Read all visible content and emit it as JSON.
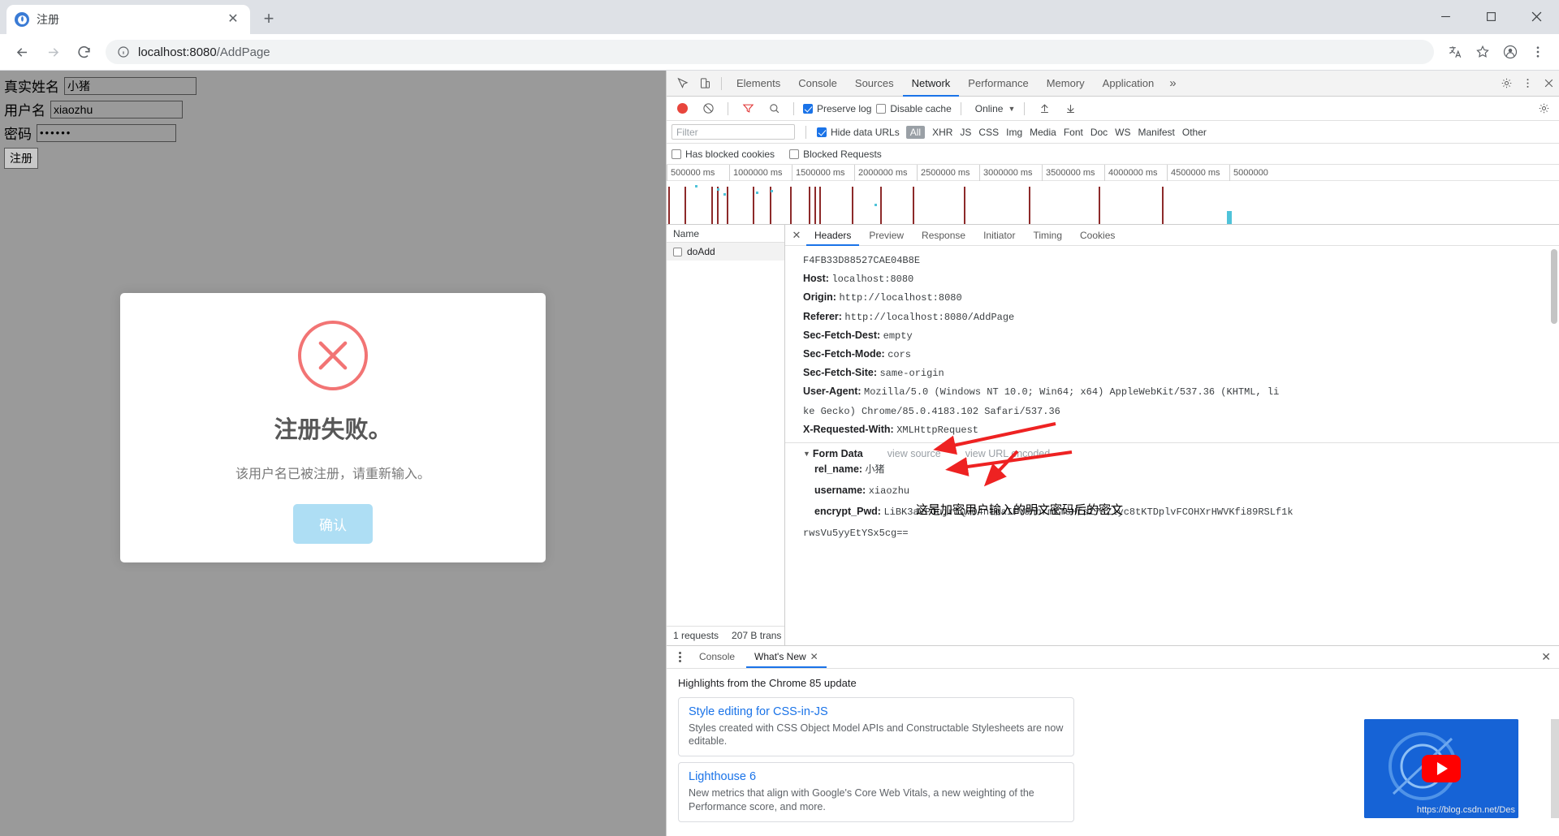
{
  "browser": {
    "tab": {
      "title": "注册",
      "close_label": "✕"
    },
    "new_tab_label": "+",
    "window_controls": {
      "minimize": "minimize-icon",
      "maximize": "maximize-icon",
      "close": "close-icon"
    },
    "nav": {
      "back": "back-icon",
      "forward": "forward-icon",
      "reload": "reload-icon"
    },
    "omnibox": {
      "info_icon": "info-icon",
      "host": "localhost:8080",
      "path": "/AddPage"
    },
    "toolbar_icons": [
      "translate-icon",
      "star-icon",
      "profile-icon",
      "menu-icon"
    ]
  },
  "page": {
    "fields": [
      {
        "label": "真实姓名",
        "value": "小猪",
        "name": "rel_name"
      },
      {
        "label": "用户名",
        "value": "xiaozhu",
        "name": "username"
      },
      {
        "label": "密码",
        "value": "••••••",
        "name": "password"
      }
    ],
    "submit_label": "注册",
    "modal": {
      "icon": "error-circle-x-icon",
      "icon_color": "#f27474",
      "title": "注册失败。",
      "message": "该用户名已被注册，请重新输入。",
      "button_label": "确认",
      "button_color": "#aedef4"
    }
  },
  "devtools": {
    "tabs": [
      "Elements",
      "Console",
      "Sources",
      "Network",
      "Performance",
      "Memory",
      "Application"
    ],
    "active_tab": "Network",
    "more_label": "»",
    "top_icons": [
      "inspect-icon",
      "device-toolbar-icon"
    ],
    "right_icons": [
      "settings-gear-icon",
      "more-vertical-icon",
      "close-icon"
    ],
    "controls": {
      "record_label": "record-icon",
      "clear_label": "clear-icon",
      "filter_label": "filter-icon",
      "search_label": "search-icon",
      "preserve_log": "Preserve log",
      "preserve_log_checked": true,
      "disable_cache": "Disable cache",
      "disable_cache_checked": false,
      "throttle": "Online",
      "import_icon": "upload-icon",
      "export_icon": "download-icon",
      "settings_icon": "gear-icon"
    },
    "filterbar": {
      "placeholder": "Filter",
      "hide_data_urls": "Hide data URLs",
      "hide_data_urls_checked": true,
      "types": [
        "All",
        "XHR",
        "JS",
        "CSS",
        "Img",
        "Media",
        "Font",
        "Doc",
        "WS",
        "Manifest",
        "Other"
      ],
      "active_type": "All"
    },
    "blockbar": {
      "has_blocked_cookies": "Has blocked cookies",
      "has_blocked_cookies_checked": false,
      "blocked_requests": "Blocked Requests",
      "blocked_requests_checked": false
    },
    "overview_ticks": [
      "500000 ms",
      "1000000 ms",
      "1500000 ms",
      "2000000 ms",
      "2500000 ms",
      "3000000 ms",
      "3500000 ms",
      "4000000 ms",
      "4500000 ms",
      "5000000"
    ],
    "requests": {
      "column_header": "Name",
      "items": [
        {
          "name": "doAdd"
        }
      ],
      "footer": {
        "count": "1 requests",
        "transferred": "207 B trans"
      }
    },
    "details": {
      "tabs": [
        "Headers",
        "Preview",
        "Response",
        "Initiator",
        "Timing",
        "Cookies"
      ],
      "active_tab": "Headers",
      "close_label": "✕",
      "headers": [
        {
          "name": "",
          "value": "F4FB33D88527CAE04B8E"
        },
        {
          "name": "Host:",
          "value": "localhost:8080"
        },
        {
          "name": "Origin:",
          "value": "http://localhost:8080"
        },
        {
          "name": "Referer:",
          "value": "http://localhost:8080/AddPage"
        },
        {
          "name": "Sec-Fetch-Dest:",
          "value": "empty"
        },
        {
          "name": "Sec-Fetch-Mode:",
          "value": "cors"
        },
        {
          "name": "Sec-Fetch-Site:",
          "value": "same-origin"
        },
        {
          "name": "User-Agent:",
          "value": "Mozilla/5.0 (Windows NT 10.0; Win64; x64) AppleWebKit/537.36 (KHTML, li"
        },
        {
          "name": "",
          "value": "ke Gecko) Chrome/85.0.4183.102 Safari/537.36"
        },
        {
          "name": "X-Requested-With:",
          "value": "XMLHttpRequest"
        }
      ],
      "form_data": {
        "title": "Form Data",
        "view_source": "view source",
        "view_url_encoded": "view URL encoded",
        "rows": [
          {
            "key": "rel_name:",
            "value": "小猪"
          },
          {
            "key": "username:",
            "value": "xiaozhu"
          },
          {
            "key": "encrypt_Pwd:",
            "value": "LiBK3aVPOujrIQv04nLoaIFV8nhrmKTsHfsZ7sZlyc8tKTDplvFCOHXrHWVKfi89RSLf1k"
          },
          {
            "key": "",
            "value": "rwsVu5yyEtYSx5cg=="
          }
        ]
      }
    },
    "annotation": "这是加密用户输入的明文密码后的密文",
    "drawer": {
      "kebab": "more-options-icon",
      "tabs": [
        "Console",
        "What's New"
      ],
      "active_tab": "What's New",
      "tab_close": "✕",
      "close_label": "✕",
      "heading": "Highlights from the Chrome 85 update",
      "cards": [
        {
          "title": "Style editing for CSS-in-JS",
          "body": "Styles created with CSS Object Model APIs and Constructable Stylesheets are now editable."
        },
        {
          "title": "Lighthouse 6",
          "body": "New metrics that align with Google's Core Web Vitals, a new weighting of the Performance score, and more."
        }
      ],
      "video": {
        "play_icon": "play-button-icon",
        "watermark": "https://blog.csdn.net/Des"
      }
    }
  }
}
